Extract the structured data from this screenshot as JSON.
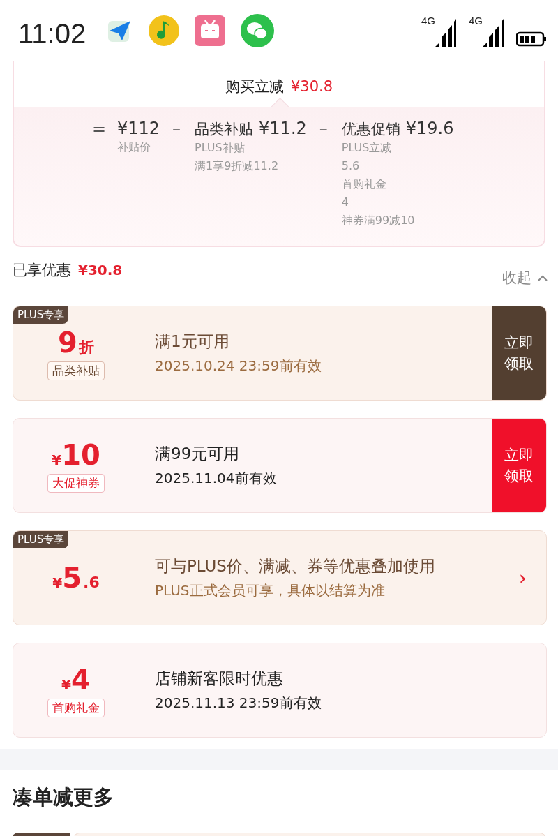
{
  "status_bar": {
    "time": "11:02",
    "signals": [
      {
        "label": "4G"
      },
      {
        "label": "4G"
      }
    ]
  },
  "summary": {
    "label": "购买立减",
    "amount": "¥30.8"
  },
  "breakdown": [
    {
      "operator": "=",
      "amount": "¥112",
      "details": [
        "补贴价"
      ]
    },
    {
      "operator": "–",
      "title": "品类补贴",
      "amount": "¥11.2",
      "details": [
        "PLUS补贴",
        "满1享9折减11.2"
      ]
    },
    {
      "operator": "–",
      "title": "优惠促销",
      "amount": "¥19.6",
      "details": [
        "PLUS立减",
        "5.6",
        "首购礼金",
        "4",
        "神券满99减10"
      ]
    }
  ],
  "enjoyed": {
    "label": "已享优惠",
    "amount": "¥30.8",
    "toggle": "收起",
    "expanded": true
  },
  "coupons": [
    {
      "kind": "plus",
      "badge": "PLUS专享",
      "value": "9",
      "suffix": "折",
      "tag": "品类补贴",
      "title": "满1元可用",
      "subtitle": "2025.10.24 23:59前有效",
      "action": {
        "kind": "button",
        "label": "立即领取"
      }
    },
    {
      "kind": "normal",
      "prefix": "¥",
      "value": "10",
      "tag": "大促神券",
      "title": "满99元可用",
      "subtitle": "2025.11.04前有效",
      "action": {
        "kind": "button",
        "label": "立即领取"
      }
    },
    {
      "kind": "plus",
      "badge": "PLUS专享",
      "prefix": "¥",
      "value": "5",
      "suffix": ".6",
      "title": "可与PLUS价、满减、券等优惠叠加使用",
      "subtitle": "PLUS正式会员可享，具体以结算为准",
      "action": {
        "kind": "chevron",
        "label": "›"
      }
    },
    {
      "kind": "normal",
      "prefix": "¥",
      "value": "4",
      "tag": "首购礼金",
      "title": "店铺新客限时优惠",
      "subtitle": "2025.11.13 23:59前有效",
      "action": {
        "kind": "none"
      }
    }
  ],
  "more_section": {
    "title": "凑单减更多"
  }
}
